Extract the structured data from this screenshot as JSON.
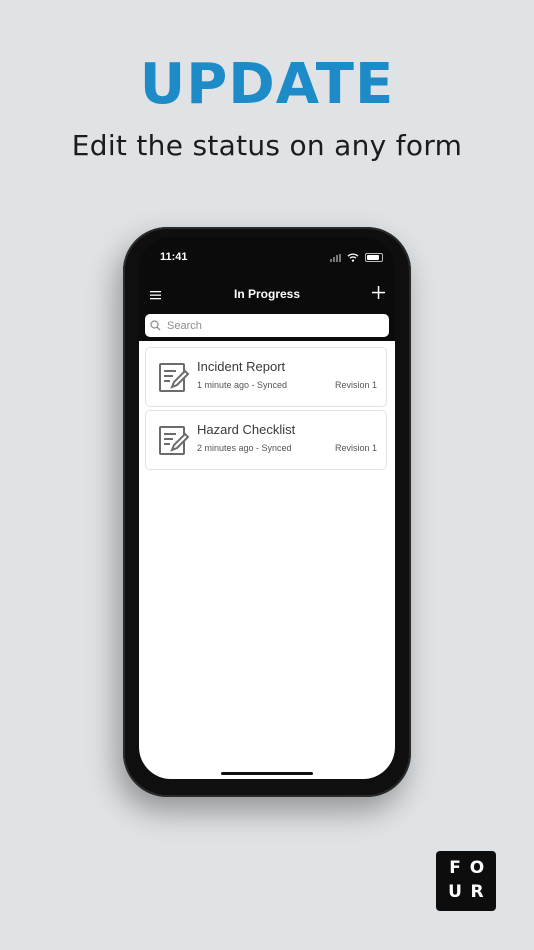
{
  "promo": {
    "headline": "UPDATE",
    "subheadline": "Edit the status on any form"
  },
  "statusbar": {
    "time": "11:41"
  },
  "navbar": {
    "title": "In Progress"
  },
  "search": {
    "placeholder": "Search"
  },
  "forms": [
    {
      "title": "Incident Report",
      "meta": "1 minute ago - Synced",
      "revision": "Revision 1"
    },
    {
      "title": "Hazard Checklist",
      "meta": "2 minutes ago - Synced",
      "revision": "Revision 1"
    }
  ],
  "logo": {
    "letters": [
      "F",
      "O",
      "U",
      "R"
    ]
  },
  "colors": {
    "accent": "#1e8bc9",
    "background": "#dfe3e5"
  },
  "icons": [
    "menu-icon",
    "plus-icon",
    "search-icon",
    "form-edit-icon",
    "wifi-icon",
    "battery-icon"
  ]
}
